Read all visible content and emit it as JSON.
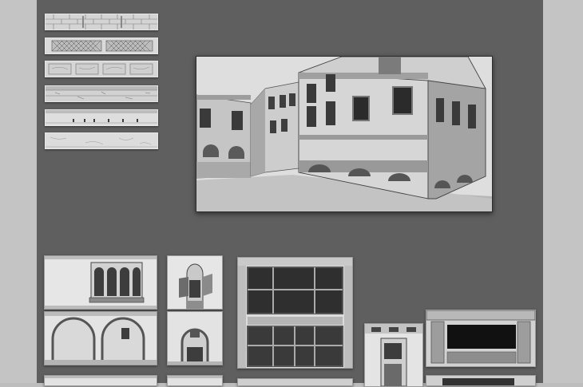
{
  "artboard": {
    "background": "#5f5f5f",
    "outer_background": "#c4c4c4"
  },
  "texture_strips": [
    {
      "pattern": "brick"
    },
    {
      "pattern": "lattice"
    },
    {
      "pattern": "tiles"
    },
    {
      "pattern": "stone-ledge"
    },
    {
      "pattern": "cornice"
    },
    {
      "pattern": "plaster"
    }
  ],
  "main_render": {
    "subject": "3d-building-render",
    "colors": {
      "sky": "#e0e0e0",
      "wall": "#c9c9c9",
      "ground": "#b5b5b5"
    }
  },
  "sketch_panels": [
    {
      "kind": "balcony-window"
    },
    {
      "kind": "arched-shuttered-window"
    },
    {
      "kind": "double-arch-facade"
    },
    {
      "kind": "single-arch-door"
    },
    {
      "kind": "storefront-grid-window"
    },
    {
      "kind": "narrow-doorway"
    },
    {
      "kind": "shop-sign-frame"
    }
  ]
}
